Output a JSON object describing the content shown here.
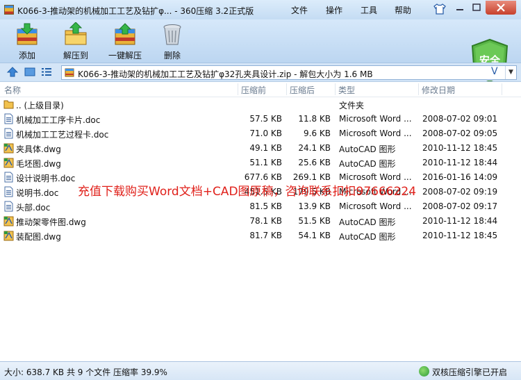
{
  "window": {
    "title": "K066-3-推动架的机械加工工艺及钻扩φ... - 360压缩 3.2正式版",
    "menu": [
      "文件",
      "操作",
      "工具",
      "帮助"
    ]
  },
  "toolbar": {
    "buttons": [
      {
        "label": "添加",
        "icon": "add-archive-icon"
      },
      {
        "label": "解压到",
        "icon": "extract-to-icon"
      },
      {
        "label": "一键解压",
        "icon": "one-click-extract-icon"
      },
      {
        "label": "删除",
        "icon": "delete-icon"
      }
    ],
    "safe_badge": "安全"
  },
  "address": {
    "path": "K066-3-推动架的机械加工工艺及钻扩φ32孔夹具设计.zip - 解包大小为 1.6 MB",
    "v_glyph": "V"
  },
  "list": {
    "columns": [
      "名称",
      "压缩前",
      "压缩后",
      "类型",
      "修改日期"
    ],
    "parent": {
      "name": ".. (上级目录)",
      "type": "文件夹"
    },
    "files": [
      {
        "name": "机械加工工序卡片.doc",
        "before": "57.5 KB",
        "after": "11.8 KB",
        "type": "Microsoft Word ...",
        "date": "2008-07-02 09:01",
        "icon": "word"
      },
      {
        "name": "机械加工工艺过程卡.doc",
        "before": "71.0 KB",
        "after": "9.6 KB",
        "type": "Microsoft Word ...",
        "date": "2008-07-02 09:05",
        "icon": "word"
      },
      {
        "name": "夹具体.dwg",
        "before": "49.1 KB",
        "after": "24.1 KB",
        "type": "AutoCAD 图形",
        "date": "2010-11-12 18:45",
        "icon": "dwg"
      },
      {
        "name": "毛坯图.dwg",
        "before": "51.1 KB",
        "after": "25.6 KB",
        "type": "AutoCAD 图形",
        "date": "2010-11-12 18:44",
        "icon": "dwg"
      },
      {
        "name": "设计说明书.doc",
        "before": "677.6 KB",
        "after": "269.1 KB",
        "type": "Microsoft Word ...",
        "date": "2016-01-16 14:09",
        "icon": "word"
      },
      {
        "name": "说明书.doc",
        "before": "451.5 KB",
        "after": "179.5 KB",
        "type": "Microsoft Word ...",
        "date": "2008-07-02 09:19",
        "icon": "word"
      },
      {
        "name": "头部.doc",
        "before": "81.5 KB",
        "after": "13.9 KB",
        "type": "Microsoft Word ...",
        "date": "2008-07-02 09:17",
        "icon": "word"
      },
      {
        "name": "推动架零件图.dwg",
        "before": "78.1 KB",
        "after": "51.5 KB",
        "type": "AutoCAD 图形",
        "date": "2010-11-12 18:44",
        "icon": "dwg"
      },
      {
        "name": "装配图.dwg",
        "before": "81.7 KB",
        "after": "54.1 KB",
        "type": "AutoCAD 图形",
        "date": "2010-11-12 18:45",
        "icon": "dwg"
      }
    ]
  },
  "watermark": "充值下载购买Word文档+CAD图原稿，咨询联系扣扣97666224",
  "status": {
    "summary": "大小: 638.7 KB 共 9 个文件 压缩率 39.9%",
    "engine": "双核压缩引擎已开启"
  }
}
